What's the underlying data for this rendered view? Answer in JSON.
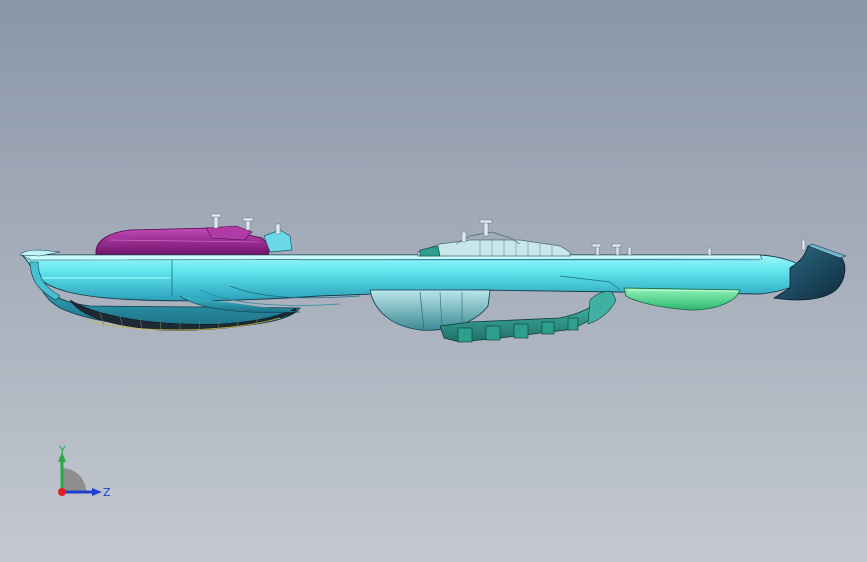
{
  "viewport": {
    "background_top": "#8a96a8",
    "background_bottom": "#c4c9d0"
  },
  "model": {
    "colors": {
      "housing": "#5fe6ee",
      "housing_shadow": "#2ea9c0",
      "housing_dark": "#1a6f86",
      "magenta_part": "#9a1f8e",
      "magenta_highlight": "#c34ab8",
      "green_lens": "#4fe08a",
      "teal_part": "#2e9e8e",
      "tip_dark": "#1b3f5a",
      "edge": "#143a4a"
    }
  },
  "triad": {
    "y_label": "Y",
    "z_label": "Z",
    "y_color": "#2aa84a",
    "z_color": "#1f3fd0",
    "origin_color": "#e02020",
    "quadrant_color": "#8e8e8e"
  }
}
